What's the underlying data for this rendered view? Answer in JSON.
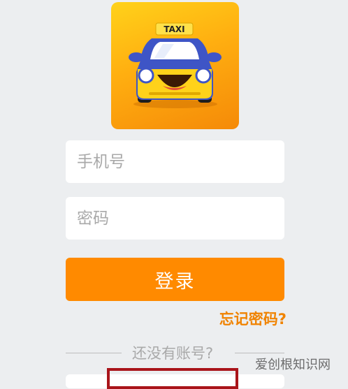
{
  "logo": {
    "sign_text": "TAXI"
  },
  "form": {
    "phone_placeholder": "手机号",
    "password_placeholder": "密码",
    "login_label": "登录",
    "forgot_label": "忘记密码?"
  },
  "register": {
    "prompt": "还没有账号?"
  },
  "watermark": "爱创根知识网",
  "colors": {
    "accent": "#ff8a00",
    "link": "#f08300",
    "background": "#eceef0",
    "highlight": "#a9141a"
  }
}
